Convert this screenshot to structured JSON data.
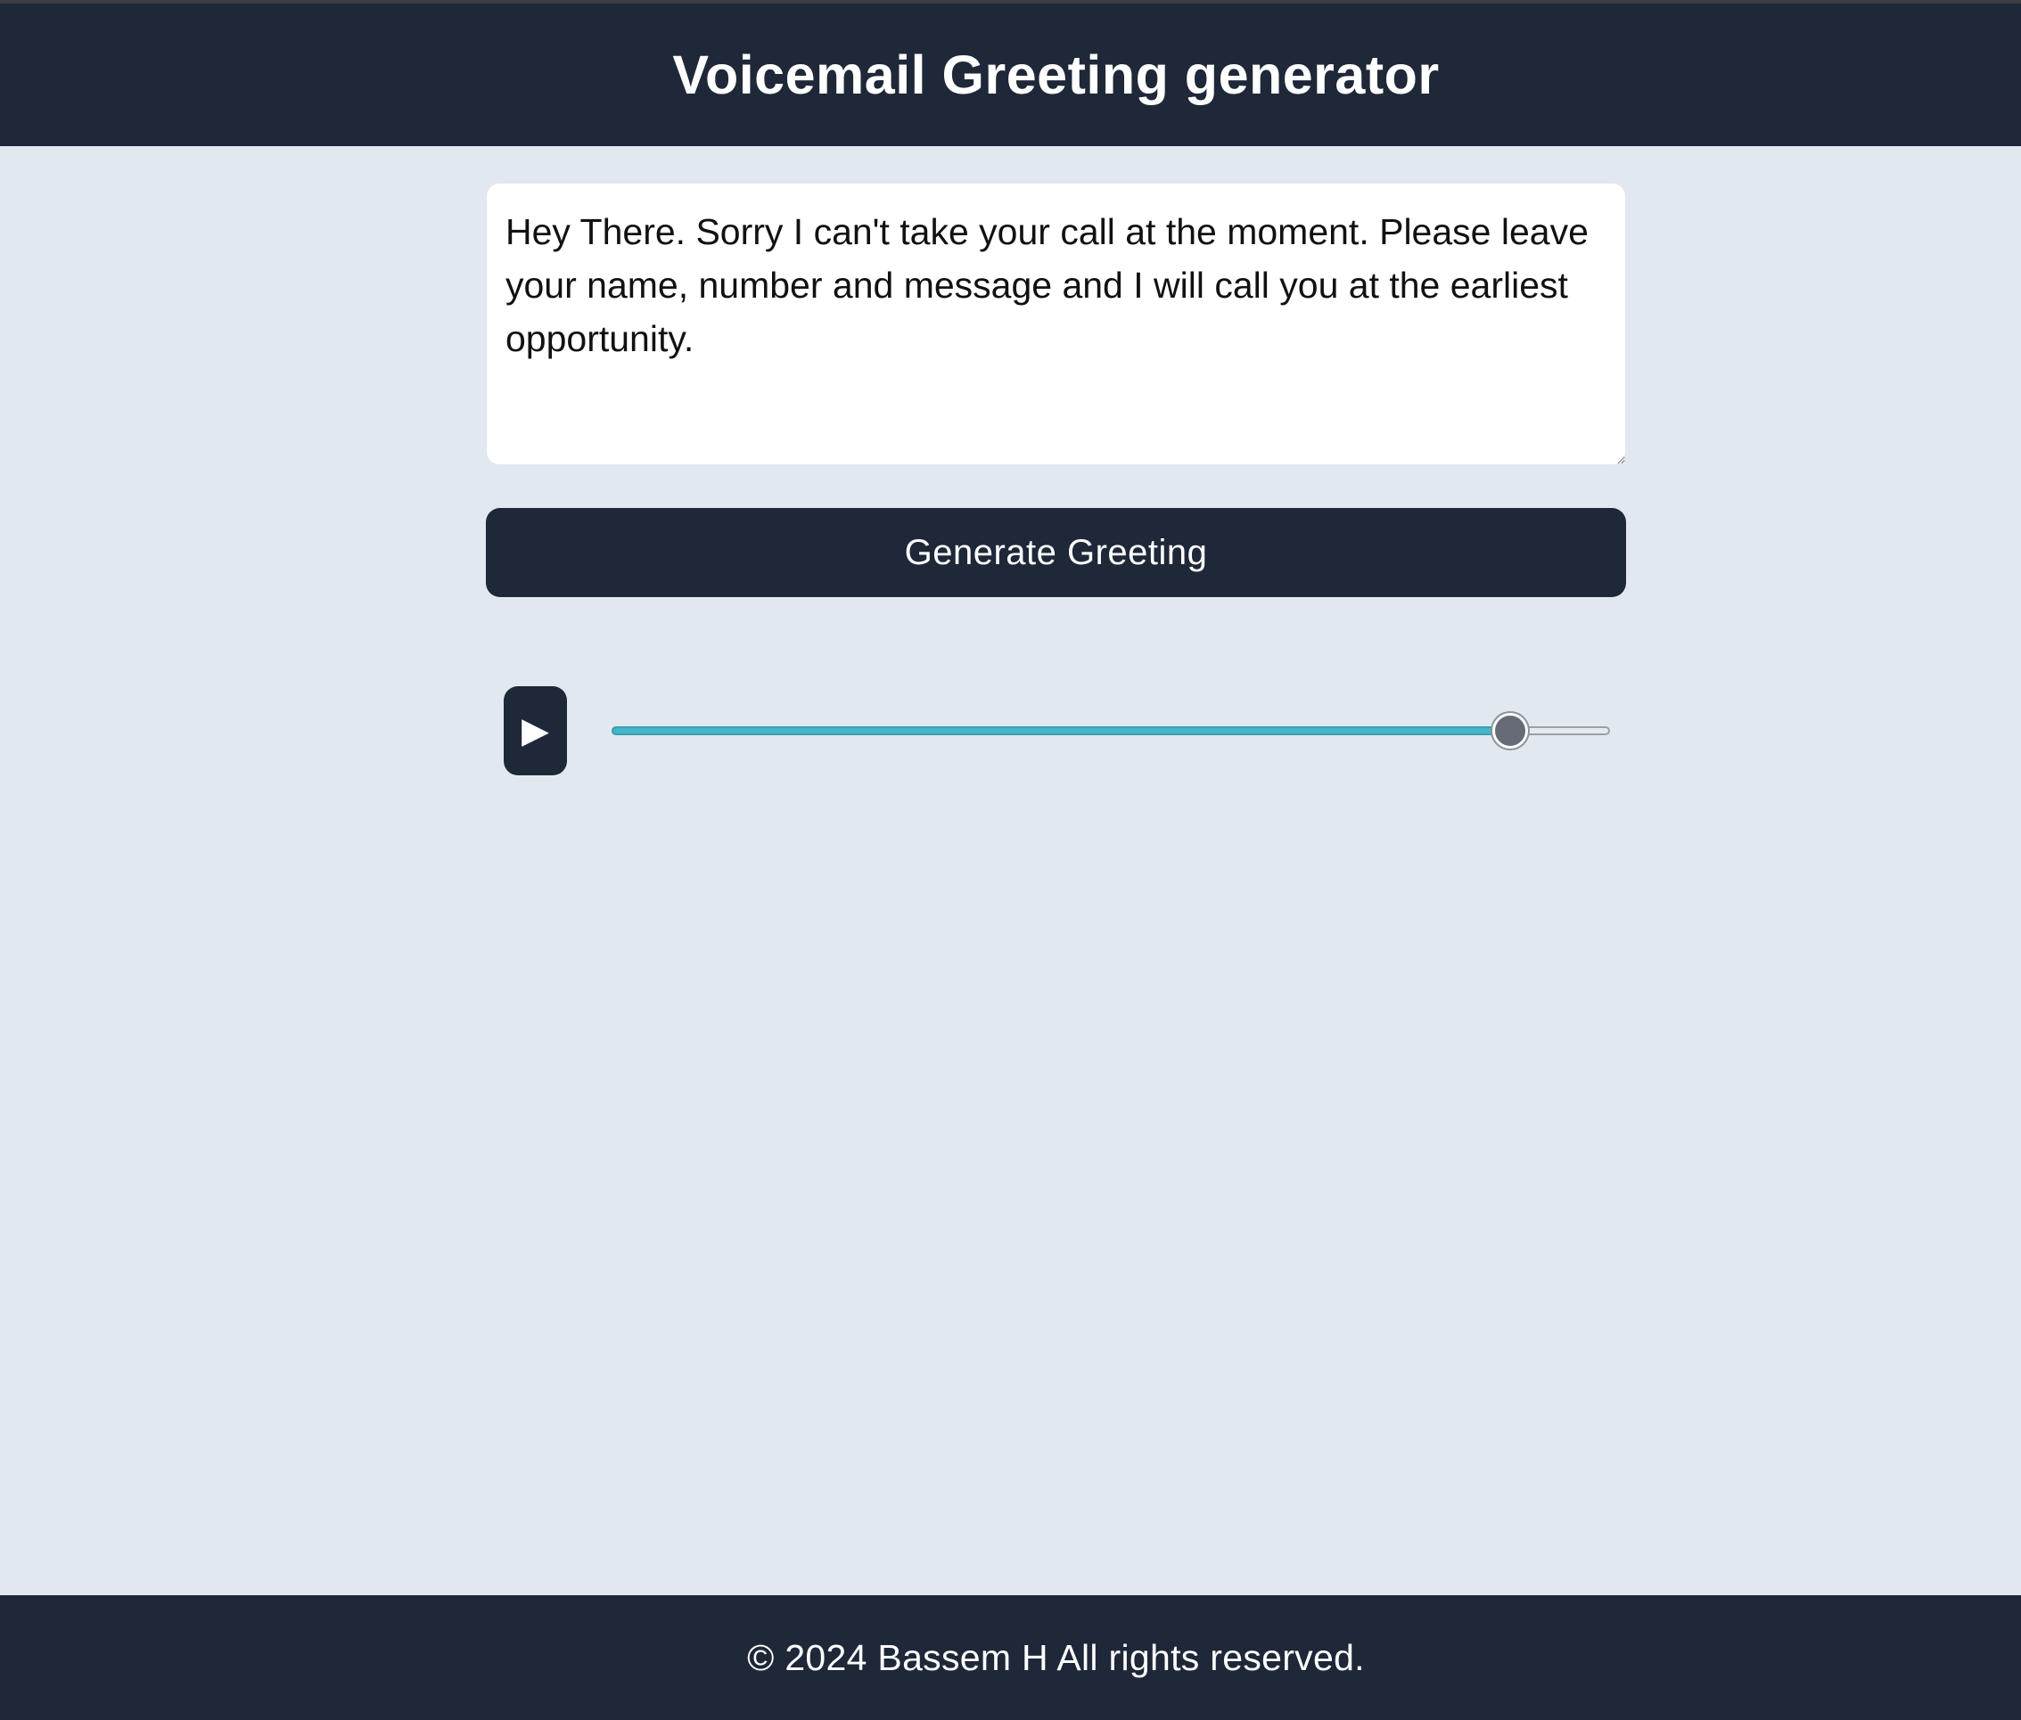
{
  "header": {
    "title": "Voicemail Greeting generator"
  },
  "greeting_input": {
    "value": "Hey There. Sorry I can't take your call at the moment. Please leave your name, number and message and I will call you at the earliest opportunity."
  },
  "generate_button": {
    "label": "Generate Greeting"
  },
  "audio_player": {
    "play_icon": "play-icon",
    "play_glyph": "▶",
    "progress_fraction": 0.9,
    "track_fill_color": "#44b6c9"
  },
  "footer": {
    "text": "© 2024 Bassem H All rights reserved."
  },
  "colors": {
    "primary_dark": "#1f2838",
    "background": "#e1e8f0",
    "accent": "#44b6c9"
  }
}
